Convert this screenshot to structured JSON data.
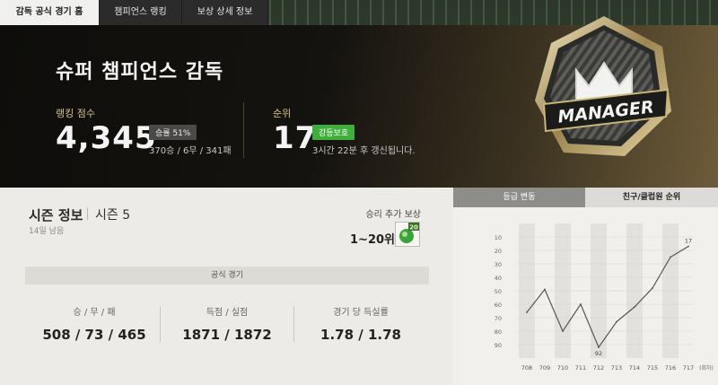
{
  "tabs": [
    {
      "label": "감독 공식 경기 홈",
      "active": true
    },
    {
      "label": "챔피언스 랭킹",
      "active": false
    },
    {
      "label": "보상 상세 정보",
      "active": false
    }
  ],
  "hero": {
    "title": "슈퍼 챔피언스 감독",
    "ranking_points_label": "랭킹 점수",
    "ranking_points": "4,345",
    "win_rate_badge": "승률 51%",
    "record": "370승 / 6무 / 341패",
    "rank_label": "순위",
    "rank": "17",
    "protection_badge": "강등보호",
    "update_notice": "3시간 22분 후 갱신됩니다.",
    "emblem_text": "MANAGER"
  },
  "season": {
    "title": "시즌 정보",
    "value": "시즌 5",
    "days_left": "14일 남음",
    "reward_label": "승리 추가 보상",
    "reward_value": "1~20위",
    "reward_badge": "20"
  },
  "official": {
    "header": "공식 경기",
    "stats": [
      {
        "label": "승 / 무 / 패",
        "value": "508 / 73 / 465"
      },
      {
        "label": "득점 / 실점",
        "value": "1871 / 1872"
      },
      {
        "label": "경기 당 득실률",
        "value": "1.78 / 1.78"
      }
    ]
  },
  "right_tabs": [
    {
      "label": "등급 변동",
      "active": true
    },
    {
      "label": "친구/클럽원 순위",
      "active": false
    }
  ],
  "chart_data": {
    "type": "line",
    "categories": [
      "708",
      "709",
      "710",
      "711",
      "712",
      "713",
      "714",
      "715",
      "716",
      "717"
    ],
    "x_unit": "(회차)",
    "values": [
      66,
      49,
      80,
      60,
      92,
      73,
      62,
      48,
      25,
      17
    ],
    "y_ticks": [
      10,
      20,
      30,
      40,
      50,
      60,
      70,
      80,
      90
    ],
    "ylim": [
      0,
      100
    ],
    "y_inverted": true,
    "point_labels": [
      {
        "index": 4,
        "text": "92"
      },
      {
        "index": 9,
        "text": "17"
      }
    ],
    "line_color": "#555555"
  },
  "colors": {
    "win_rate_badge_bg": "#4a4a48",
    "protection_badge_bg": "#3fae3a",
    "gold_label": "#d8c38e"
  }
}
